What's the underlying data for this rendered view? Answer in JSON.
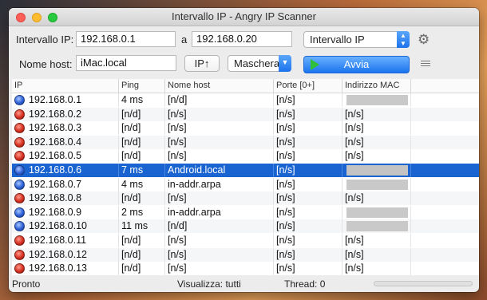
{
  "window": {
    "title": "Intervallo IP - Angry IP Scanner"
  },
  "toolbar": {
    "range_label": "Intervallo IP:",
    "range_from": "192.168.0.1",
    "range_to_label": "a",
    "range_to": "192.168.0.20",
    "mode_select": "Intervallo IP",
    "hostname_label": "Nome host:",
    "hostname_value": "iMac.local",
    "ip_up_button": "IP↑",
    "mask_select": "Maschera",
    "start_button": "Avvia"
  },
  "table": {
    "columns": [
      "IP",
      "Ping",
      "Nome host",
      "Porte [0+]",
      "Indirizzo MAC"
    ],
    "rows": [
      {
        "status": "alive",
        "ip": "192.168.0.1",
        "ping": "4 ms",
        "host": "[n/d]",
        "ports": "[n/s]",
        "mac": "",
        "mac_hidden": true
      },
      {
        "status": "dead",
        "ip": "192.168.0.2",
        "ping": "[n/d]",
        "host": "[n/s]",
        "ports": "[n/s]",
        "mac": "[n/s]",
        "mac_hidden": false
      },
      {
        "status": "dead",
        "ip": "192.168.0.3",
        "ping": "[n/d]",
        "host": "[n/s]",
        "ports": "[n/s]",
        "mac": "[n/s]",
        "mac_hidden": false
      },
      {
        "status": "dead",
        "ip": "192.168.0.4",
        "ping": "[n/d]",
        "host": "[n/s]",
        "ports": "[n/s]",
        "mac": "[n/s]",
        "mac_hidden": false
      },
      {
        "status": "dead",
        "ip": "192.168.0.5",
        "ping": "[n/d]",
        "host": "[n/s]",
        "ports": "[n/s]",
        "mac": "[n/s]",
        "mac_hidden": false
      },
      {
        "status": "alive",
        "ip": "192.168.0.6",
        "ping": "7 ms",
        "host": "Android.local",
        "ports": "[n/s]",
        "mac": "",
        "mac_hidden": true,
        "selected": true
      },
      {
        "status": "alive",
        "ip": "192.168.0.7",
        "ping": "4 ms",
        "host": "in-addr.arpa",
        "ports": "[n/s]",
        "mac": "",
        "mac_hidden": true
      },
      {
        "status": "dead",
        "ip": "192.168.0.8",
        "ping": "[n/d]",
        "host": "[n/s]",
        "ports": "[n/s]",
        "mac": "[n/s]",
        "mac_hidden": false
      },
      {
        "status": "alive",
        "ip": "192.168.0.9",
        "ping": "2 ms",
        "host": "in-addr.arpa",
        "ports": "[n/s]",
        "mac": "",
        "mac_hidden": true
      },
      {
        "status": "alive",
        "ip": "192.168.0.10",
        "ping": "11 ms",
        "host": "[n/d]",
        "ports": "[n/s]",
        "mac": "",
        "mac_hidden": true
      },
      {
        "status": "dead",
        "ip": "192.168.0.11",
        "ping": "[n/d]",
        "host": "[n/s]",
        "ports": "[n/s]",
        "mac": "[n/s]",
        "mac_hidden": false
      },
      {
        "status": "dead",
        "ip": "192.168.0.12",
        "ping": "[n/d]",
        "host": "[n/s]",
        "ports": "[n/s]",
        "mac": "[n/s]",
        "mac_hidden": false
      },
      {
        "status": "dead",
        "ip": "192.168.0.13",
        "ping": "[n/d]",
        "host": "[n/s]",
        "ports": "[n/s]",
        "mac": "[n/s]",
        "mac_hidden": false
      }
    ]
  },
  "statusbar": {
    "state": "Pronto",
    "display": "Visualizza: tutti",
    "threads": "Thread: 0",
    "progress": 0
  },
  "colors": {
    "accent": "#1a64d2",
    "alive": "#2d5fd6",
    "dead": "#d42f21",
    "start_play": "#2fbf3b"
  },
  "icons": {
    "settings": "gear-icon",
    "list": "list-icon",
    "alive": "alive-status-icon",
    "dead": "dead-status-icon",
    "start": "play-icon"
  }
}
